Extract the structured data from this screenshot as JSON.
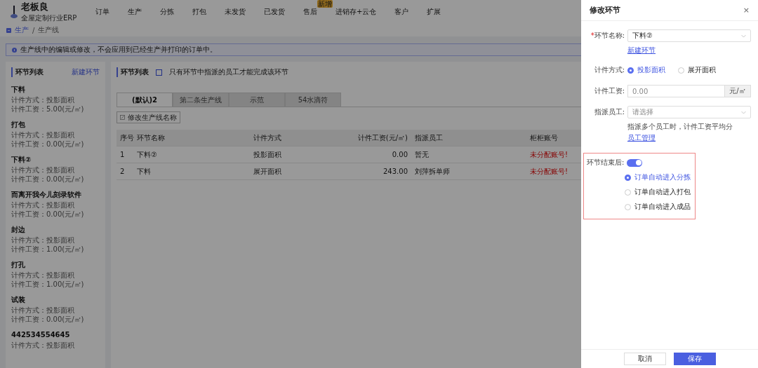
{
  "header": {
    "brand": "老板良",
    "subtitle": "全屋定制行业ERP",
    "nav": [
      {
        "label": "订单"
      },
      {
        "label": "生产"
      },
      {
        "label": "分拣"
      },
      {
        "label": "打包"
      },
      {
        "label": "未发货"
      },
      {
        "label": "已发货"
      },
      {
        "label": "售后",
        "badge": "新增"
      },
      {
        "label": "进销存+云仓"
      },
      {
        "label": "客户"
      },
      {
        "label": "扩展"
      }
    ]
  },
  "breadcrumb": [
    "生产",
    "/",
    "生产线"
  ],
  "notice": "生产线中的编辑或修改，不会应用到已经生产并打印的订单中。",
  "left_panel": {
    "title": "环节列表",
    "action": "新建环节",
    "items": [
      {
        "name": "下料",
        "lines": [
          "计件方式：投影面积",
          "计件工资：5.00(元/㎡)"
        ]
      },
      {
        "name": "打包",
        "lines": [
          "计件方式：投影面积",
          "计件工资：0.00(元/㎡)"
        ]
      },
      {
        "name": "下料②",
        "lines": [
          "计件方式：投影面积",
          "计件工资：0.00(元/㎡)"
        ]
      },
      {
        "name": "而离开我今儿刻录软件",
        "lines": [
          "计件方式：投影面积",
          "计件工资：0.00(元/㎡)"
        ]
      },
      {
        "name": "封边",
        "lines": [
          "计件方式：投影面积",
          "计件工资：1.00(元/㎡)"
        ]
      },
      {
        "name": "打孔",
        "lines": [
          "计件方式：投影面积",
          "计件工资：1.00(元/㎡)"
        ]
      },
      {
        "name": "试装",
        "lines": [
          "计件方式：投影面积",
          "计件工资：0.00(元/㎡)"
        ]
      },
      {
        "name": "442534554645",
        "lines": [
          "计件方式：投影面积"
        ]
      }
    ]
  },
  "main": {
    "title": "环节列表",
    "restrict": {
      "label": "只有环节中指派的员工才能完成该环节",
      "checked": false
    },
    "tabs": [
      {
        "label": "(默认)2",
        "selected": true
      },
      {
        "label": "第二条生产线",
        "selected": false
      },
      {
        "label": "示范",
        "selected": false
      },
      {
        "label": "54水滴符",
        "selected": false
      }
    ],
    "rename_button": "修改生产线名称",
    "table": {
      "columns": [
        "序号",
        "环节名称",
        "计件方式",
        "计件工资(元/㎡)",
        "指派员工",
        "柜柜账号"
      ],
      "rows": [
        [
          "1",
          "下料②",
          "投影面积",
          "0.00",
          "暂无",
          "未分配账号!"
        ],
        [
          "2",
          "下料",
          "展开面积",
          "243.00",
          "刘萍拆单师",
          "未分配账号!"
        ]
      ]
    }
  },
  "drawer": {
    "title": "修改环节",
    "close": "×",
    "required_mark": "*",
    "name_label": "环节名称:",
    "name_value": "下料②",
    "new_link": "新建环节",
    "method_label": "计件方式:",
    "methods": [
      {
        "label": "投影面积",
        "selected": true
      },
      {
        "label": "展开面积",
        "selected": false
      }
    ],
    "wage_label": "计件工资:",
    "wage_placeholder": "0.00",
    "wage_unit": "元/㎡",
    "staff_label": "指派员工:",
    "staff_placeholder": "请选择",
    "staff_help": "指派多个员工时，计件工资平均分",
    "staff_link": "员工管理",
    "after": {
      "label": "环节结束后:",
      "on": true,
      "options": [
        {
          "label": "订单自动进入分拣",
          "selected": true
        },
        {
          "label": "订单自动进入打包",
          "selected": false
        },
        {
          "label": "订单自动进入成品",
          "selected": false
        }
      ]
    },
    "buttons": [
      "取消",
      "保存"
    ]
  }
}
